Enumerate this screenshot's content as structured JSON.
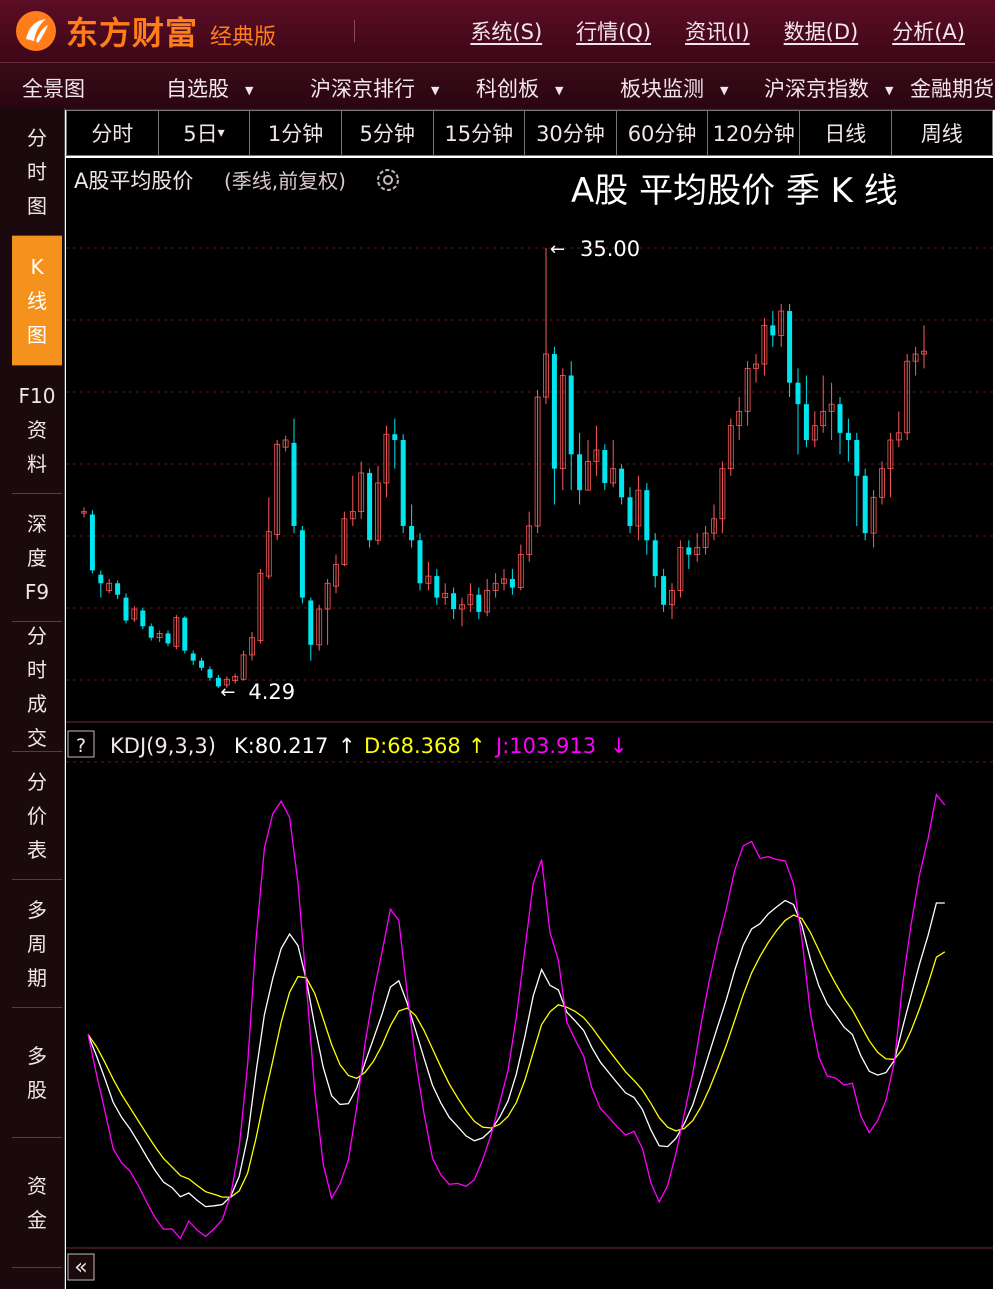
{
  "app": {
    "brand": "东方财富",
    "edition": "经典版",
    "menu": [
      "系统(S)",
      "行情(Q)",
      "资讯(I)",
      "数据(D)",
      "分析(A)"
    ]
  },
  "navbar": [
    {
      "label": "全景图",
      "dropdown": false
    },
    {
      "label": "自选股",
      "dropdown": true
    },
    {
      "label": "沪深京排行",
      "dropdown": true
    },
    {
      "label": "科创板",
      "dropdown": true
    },
    {
      "label": "板块监测",
      "dropdown": true
    },
    {
      "label": "沪深京指数",
      "dropdown": true
    },
    {
      "label": "金融期货",
      "dropdown": false
    }
  ],
  "sidebar": [
    {
      "label": "分时图",
      "active": false
    },
    {
      "label": "K线图",
      "active": true
    },
    {
      "label": "F10资料",
      "active": false
    },
    {
      "label": "深度F9",
      "active": false
    },
    {
      "label": "分时成交",
      "active": false
    },
    {
      "label": "分价表",
      "active": false
    },
    {
      "label": "多周期",
      "active": false
    },
    {
      "label": "多股",
      "active": false
    },
    {
      "label": "资金",
      "active": false
    }
  ],
  "timeframes": [
    "分时",
    "5日",
    "1分钟",
    "5分钟",
    "15分钟",
    "30分钟",
    "60分钟",
    "120分钟",
    "日线",
    "周线"
  ],
  "chart": {
    "title": "A股平均股价",
    "subtitle": "(季线,前复权)",
    "overlay_title": "A股 平均股价  季 K 线",
    "max_label": "35.00",
    "min_label": "4.29",
    "colors": {
      "up": "#ff5a5a",
      "down": "#00e5ee",
      "k": "#ffffff",
      "d": "#ffff00",
      "j": "#ff00ff"
    }
  },
  "kdj": {
    "help": "?",
    "name": "KDJ(9,3,3)",
    "k": "K:80.217",
    "d": "D:68.368",
    "j": "J:103.913",
    "k_arrow": "↑",
    "d_arrow": "↑",
    "j_arrow": "↓"
  },
  "chart_data": {
    "type": "candlestick",
    "high": 35.0,
    "low": 4.29,
    "candles": [
      {
        "o": 16.5,
        "c": 16.6,
        "h": 16.9,
        "l": 16.2
      },
      {
        "o": 16.4,
        "c": 12.5,
        "h": 16.7,
        "l": 12.3
      },
      {
        "o": 12.2,
        "c": 11.6,
        "h": 12.5,
        "l": 10.6
      },
      {
        "o": 11.1,
        "c": 11.6,
        "h": 11.9,
        "l": 10.9
      },
      {
        "o": 11.6,
        "c": 10.8,
        "h": 11.8,
        "l": 10.5
      },
      {
        "o": 10.6,
        "c": 9.0,
        "h": 10.9,
        "l": 8.8
      },
      {
        "o": 9.1,
        "c": 9.8,
        "h": 10.0,
        "l": 8.9
      },
      {
        "o": 9.7,
        "c": 8.6,
        "h": 9.9,
        "l": 8.4
      },
      {
        "o": 8.6,
        "c": 7.8,
        "h": 8.8,
        "l": 7.6
      },
      {
        "o": 7.8,
        "c": 8.1,
        "h": 8.3,
        "l": 7.5
      },
      {
        "o": 8.1,
        "c": 7.4,
        "h": 8.3,
        "l": 7.2
      },
      {
        "o": 7.2,
        "c": 9.2,
        "h": 9.4,
        "l": 7.0
      },
      {
        "o": 9.2,
        "c": 6.9,
        "h": 9.3,
        "l": 6.7
      },
      {
        "o": 6.7,
        "c": 6.2,
        "h": 6.9,
        "l": 5.9
      },
      {
        "o": 6.2,
        "c": 5.7,
        "h": 6.4,
        "l": 5.5
      },
      {
        "o": 5.6,
        "c": 5.0,
        "h": 5.8,
        "l": 4.8
      },
      {
        "o": 5.0,
        "c": 4.4,
        "h": 5.2,
        "l": 4.29
      },
      {
        "o": 4.5,
        "c": 4.9,
        "h": 5.1,
        "l": 4.3
      },
      {
        "o": 4.8,
        "c": 5.1,
        "h": 5.3,
        "l": 4.6
      },
      {
        "o": 4.9,
        "c": 6.6,
        "h": 6.9,
        "l": 4.8
      },
      {
        "o": 6.6,
        "c": 7.8,
        "h": 8.2,
        "l": 6.2
      },
      {
        "o": 7.6,
        "c": 12.3,
        "h": 12.6,
        "l": 7.4
      },
      {
        "o": 12.1,
        "c": 15.2,
        "h": 17.6,
        "l": 11.9
      },
      {
        "o": 15.0,
        "c": 21.3,
        "h": 21.6,
        "l": 14.6
      },
      {
        "o": 21.1,
        "c": 21.6,
        "h": 21.9,
        "l": 20.8
      },
      {
        "o": 21.4,
        "c": 15.6,
        "h": 23.1,
        "l": 15.1
      },
      {
        "o": 15.3,
        "c": 10.6,
        "h": 15.6,
        "l": 10.2
      },
      {
        "o": 10.4,
        "c": 7.3,
        "h": 10.6,
        "l": 6.2
      },
      {
        "o": 7.3,
        "c": 9.8,
        "h": 10.1,
        "l": 6.9
      },
      {
        "o": 9.8,
        "c": 11.6,
        "h": 11.9,
        "l": 7.3
      },
      {
        "o": 11.4,
        "c": 12.9,
        "h": 13.6,
        "l": 10.9
      },
      {
        "o": 12.9,
        "c": 16.1,
        "h": 16.6,
        "l": 12.8
      },
      {
        "o": 16.1,
        "c": 16.6,
        "h": 19.1,
        "l": 15.6
      },
      {
        "o": 16.6,
        "c": 19.3,
        "h": 20.1,
        "l": 16.1
      },
      {
        "o": 19.3,
        "c": 14.6,
        "h": 19.6,
        "l": 14.1
      },
      {
        "o": 14.6,
        "c": 18.6,
        "h": 19.8,
        "l": 14.3
      },
      {
        "o": 18.6,
        "c": 22.0,
        "h": 22.6,
        "l": 17.6
      },
      {
        "o": 22.0,
        "c": 21.6,
        "h": 23.1,
        "l": 19.6
      },
      {
        "o": 21.6,
        "c": 15.6,
        "h": 22.0,
        "l": 15.1
      },
      {
        "o": 15.6,
        "c": 14.6,
        "h": 17.1,
        "l": 14.1
      },
      {
        "o": 14.6,
        "c": 11.6,
        "h": 15.1,
        "l": 11.1
      },
      {
        "o": 11.6,
        "c": 12.1,
        "h": 13.1,
        "l": 11.1
      },
      {
        "o": 12.1,
        "c": 10.6,
        "h": 12.6,
        "l": 10.1
      },
      {
        "o": 10.6,
        "c": 10.9,
        "h": 11.6,
        "l": 10.1
      },
      {
        "o": 10.9,
        "c": 9.8,
        "h": 11.3,
        "l": 9.1
      },
      {
        "o": 9.8,
        "c": 10.1,
        "h": 10.6,
        "l": 8.6
      },
      {
        "o": 10.1,
        "c": 10.8,
        "h": 11.6,
        "l": 9.6
      },
      {
        "o": 10.8,
        "c": 9.6,
        "h": 11.3,
        "l": 9.1
      },
      {
        "o": 9.6,
        "c": 11.1,
        "h": 11.9,
        "l": 9.3
      },
      {
        "o": 11.1,
        "c": 11.6,
        "h": 12.3,
        "l": 10.6
      },
      {
        "o": 11.6,
        "c": 11.9,
        "h": 12.6,
        "l": 11.1
      },
      {
        "o": 11.9,
        "c": 11.3,
        "h": 12.6,
        "l": 10.8
      },
      {
        "o": 11.3,
        "c": 13.6,
        "h": 14.3,
        "l": 11.1
      },
      {
        "o": 13.6,
        "c": 15.6,
        "h": 16.6,
        "l": 13.1
      },
      {
        "o": 15.6,
        "c": 24.6,
        "h": 25.1,
        "l": 15.1
      },
      {
        "o": 24.6,
        "c": 27.6,
        "h": 35.0,
        "l": 24.1
      },
      {
        "o": 27.6,
        "c": 19.6,
        "h": 28.1,
        "l": 17.1
      },
      {
        "o": 19.6,
        "c": 26.1,
        "h": 26.6,
        "l": 18.1
      },
      {
        "o": 26.1,
        "c": 20.6,
        "h": 27.1,
        "l": 18.1
      },
      {
        "o": 20.6,
        "c": 18.1,
        "h": 22.1,
        "l": 17.1
      },
      {
        "o": 18.1,
        "c": 20.1,
        "h": 21.6,
        "l": 18.1
      },
      {
        "o": 20.1,
        "c": 20.9,
        "h": 22.6,
        "l": 19.1
      },
      {
        "o": 20.9,
        "c": 18.6,
        "h": 21.3,
        "l": 18.1
      },
      {
        "o": 18.6,
        "c": 19.6,
        "h": 21.6,
        "l": 18.3
      },
      {
        "o": 19.6,
        "c": 17.6,
        "h": 19.9,
        "l": 17.1
      },
      {
        "o": 17.6,
        "c": 15.6,
        "h": 18.3,
        "l": 15.1
      },
      {
        "o": 15.6,
        "c": 18.1,
        "h": 19.1,
        "l": 14.6
      },
      {
        "o": 18.1,
        "c": 14.6,
        "h": 18.6,
        "l": 13.6
      },
      {
        "o": 14.6,
        "c": 12.1,
        "h": 15.1,
        "l": 11.3
      },
      {
        "o": 12.1,
        "c": 10.1,
        "h": 12.6,
        "l": 9.6
      },
      {
        "o": 10.1,
        "c": 11.1,
        "h": 11.6,
        "l": 9.1
      },
      {
        "o": 11.1,
        "c": 14.1,
        "h": 14.6,
        "l": 10.6
      },
      {
        "o": 14.1,
        "c": 13.6,
        "h": 14.6,
        "l": 12.6
      },
      {
        "o": 13.6,
        "c": 14.1,
        "h": 15.1,
        "l": 13.1
      },
      {
        "o": 14.1,
        "c": 15.1,
        "h": 15.6,
        "l": 13.6
      },
      {
        "o": 15.1,
        "c": 16.1,
        "h": 17.1,
        "l": 14.6
      },
      {
        "o": 16.1,
        "c": 19.6,
        "h": 20.1,
        "l": 15.1
      },
      {
        "o": 19.6,
        "c": 22.6,
        "h": 23.1,
        "l": 19.1
      },
      {
        "o": 22.6,
        "c": 23.6,
        "h": 24.6,
        "l": 21.6
      },
      {
        "o": 23.6,
        "c": 26.6,
        "h": 27.1,
        "l": 22.6
      },
      {
        "o": 26.6,
        "c": 26.9,
        "h": 27.6,
        "l": 25.6
      },
      {
        "o": 26.9,
        "c": 29.6,
        "h": 30.1,
        "l": 26.1
      },
      {
        "o": 29.6,
        "c": 28.9,
        "h": 30.6,
        "l": 28.1
      },
      {
        "o": 28.9,
        "c": 30.6,
        "h": 31.1,
        "l": 28.1
      },
      {
        "o": 30.6,
        "c": 25.6,
        "h": 31.1,
        "l": 24.6
      },
      {
        "o": 25.6,
        "c": 24.1,
        "h": 26.6,
        "l": 20.6
      },
      {
        "o": 24.1,
        "c": 21.6,
        "h": 26.1,
        "l": 21.1
      },
      {
        "o": 21.6,
        "c": 22.6,
        "h": 23.6,
        "l": 21.1
      },
      {
        "o": 22.6,
        "c": 23.6,
        "h": 26.1,
        "l": 22.1
      },
      {
        "o": 23.6,
        "c": 24.1,
        "h": 25.6,
        "l": 21.6
      },
      {
        "o": 24.1,
        "c": 22.1,
        "h": 24.6,
        "l": 20.6
      },
      {
        "o": 22.1,
        "c": 21.6,
        "h": 23.1,
        "l": 20.1
      },
      {
        "o": 21.6,
        "c": 19.1,
        "h": 22.1,
        "l": 15.6
      },
      {
        "o": 19.1,
        "c": 15.1,
        "h": 19.6,
        "l": 14.6
      },
      {
        "o": 15.1,
        "c": 17.6,
        "h": 18.1,
        "l": 14.1
      },
      {
        "o": 17.6,
        "c": 19.6,
        "h": 20.1,
        "l": 17.1
      },
      {
        "o": 19.6,
        "c": 21.6,
        "h": 22.1,
        "l": 17.6
      },
      {
        "o": 21.6,
        "c": 22.1,
        "h": 23.6,
        "l": 21.1
      },
      {
        "o": 22.1,
        "c": 27.1,
        "h": 27.6,
        "l": 21.6
      },
      {
        "o": 27.1,
        "c": 27.6,
        "h": 28.1,
        "l": 26.1
      },
      {
        "o": 27.6,
        "c": 27.8,
        "h": 29.6,
        "l": 26.6
      }
    ],
    "k_series": [
      48.4,
      43.3,
      37.8,
      32.0,
      28.4,
      25.6,
      22.3,
      18.8,
      15.5,
      12.7,
      11.4,
      9.2,
      10.1,
      8.3,
      6.8,
      7.0,
      7.3,
      9.3,
      14.1,
      23.6,
      39.3,
      53.2,
      62.0,
      69.2,
      72.7,
      69.9,
      61.5,
      50.4,
      40.5,
      33.6,
      31.5,
      31.7,
      35.5,
      41.7,
      47.5,
      53.3,
      59.9,
      61.4,
      56.0,
      49.4,
      42.7,
      36.2,
      31.9,
      28.4,
      26.2,
      23.9,
      22.7,
      23.4,
      25.3,
      28.4,
      32.3,
      38.9,
      47.8,
      57.7,
      64.1,
      60.3,
      59.2,
      53.8,
      51.7,
      49.4,
      45.2,
      41.7,
      39.2,
      36.7,
      34.3,
      33.2,
      30.3,
      25.4,
      21.5,
      21.3,
      23.3,
      26.9,
      31.4,
      37.7,
      44.2,
      50.6,
      56.9,
      64.0,
      70.0,
      73.9,
      75.2,
      77.6,
      79.3,
      80.8,
      79.8,
      74.7,
      66.6,
      60.2,
      55.8,
      53.1,
      50.2,
      48.4,
      43.3,
      39.5,
      38.6,
      39.2,
      42.2,
      50.3,
      58.0,
      65.5,
      72.3,
      80.2,
      80.2
    ],
    "d_series": [
      48.4,
      45.5,
      41.7,
      37.6,
      33.9,
      30.7,
      27.5,
      24.3,
      21.2,
      18.4,
      16.4,
      14.3,
      13.5,
      11.9,
      10.4,
      9.8,
      9.1,
      9.1,
      10.6,
      14.9,
      23.3,
      33.1,
      42.1,
      51.4,
      58.6,
      62.4,
      62.1,
      58.3,
      52.2,
      46.0,
      41.1,
      38.5,
      37.8,
      39.3,
      42.0,
      45.8,
      50.5,
      54.1,
      54.8,
      53.0,
      49.4,
      45.0,
      40.6,
      36.5,
      33.1,
      30.0,
      27.4,
      26.0,
      25.8,
      26.7,
      28.6,
      32.0,
      37.3,
      44.1,
      50.8,
      53.9,
      55.6,
      55.0,
      54.0,
      52.5,
      50.1,
      47.3,
      44.6,
      42.0,
      39.4,
      37.3,
      35.0,
      31.8,
      28.3,
      26.0,
      25.1,
      25.7,
      27.6,
      31.0,
      35.4,
      40.5,
      45.9,
      51.9,
      58.0,
      63.3,
      67.3,
      70.7,
      73.6,
      76.0,
      77.3,
      76.4,
      73.1,
      68.8,
      64.5,
      60.7,
      57.2,
      54.3,
      50.6,
      46.9,
      44.1,
      42.5,
      42.4,
      45.0,
      49.4,
      54.7,
      60.6,
      67.1,
      68.4
    ],
    "j_series": [
      48.4,
      38.9,
      30.0,
      20.8,
      17.4,
      15.4,
      11.9,
      7.8,
      4.1,
      1.3,
      1.4,
      -0.9,
      3.3,
      1.1,
      -0.4,
      1.4,
      3.7,
      9.7,
      21.1,
      41.0,
      71.3,
      93.4,
      101.8,
      104.8,
      100.9,
      84.9,
      60.3,
      34.6,
      17.1,
      8.8,
      12.3,
      18.1,
      30.9,
      46.5,
      58.5,
      68.3,
      78.7,
      76.0,
      58.4,
      42.2,
      29.3,
      18.6,
      14.5,
      12.2,
      12.4,
      11.7,
      13.3,
      18.2,
      24.3,
      31.8,
      39.7,
      52.7,
      68.8,
      84.9,
      90.7,
      73.1,
      66.4,
      51.4,
      47.1,
      43.2,
      35.4,
      30.5,
      28.4,
      26.1,
      24.1,
      25.0,
      20.9,
      12.6,
      7.9,
      11.9,
      19.7,
      29.3,
      39.0,
      51.1,
      61.8,
      70.8,
      78.9,
      88.2,
      94.0,
      95.1,
      91.0,
      91.4,
      90.7,
      90.4,
      84.8,
      71.3,
      53.6,
      43.0,
      38.4,
      37.9,
      36.2,
      36.6,
      28.7,
      24.7,
      27.6,
      32.6,
      41.8,
      60.9,
      75.2,
      87.1,
      95.7,
      106.4,
      103.9
    ]
  }
}
